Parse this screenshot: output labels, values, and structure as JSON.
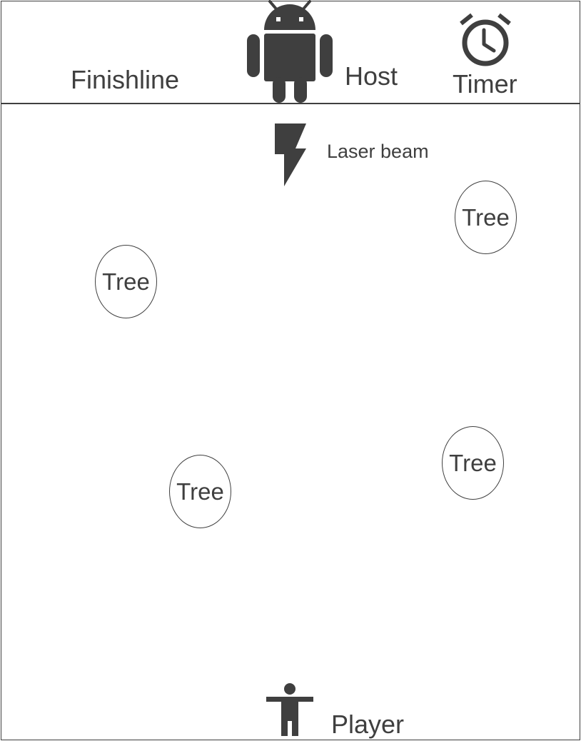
{
  "colors": {
    "ink": "#3f3f3f",
    "background": "#ffffff"
  },
  "header": {
    "finishline_label": "Finishline",
    "host_label": "Host",
    "host_icon": "android-icon",
    "timer_label": "Timer",
    "timer_icon": "alarm-clock-icon"
  },
  "laser": {
    "label": "Laser beam",
    "icon": "lightning-bolt-icon"
  },
  "trees": [
    {
      "label": "Tree"
    },
    {
      "label": "Tree"
    },
    {
      "label": "Tree"
    },
    {
      "label": "Tree"
    }
  ],
  "player": {
    "label": "Player",
    "icon": "person-icon"
  }
}
